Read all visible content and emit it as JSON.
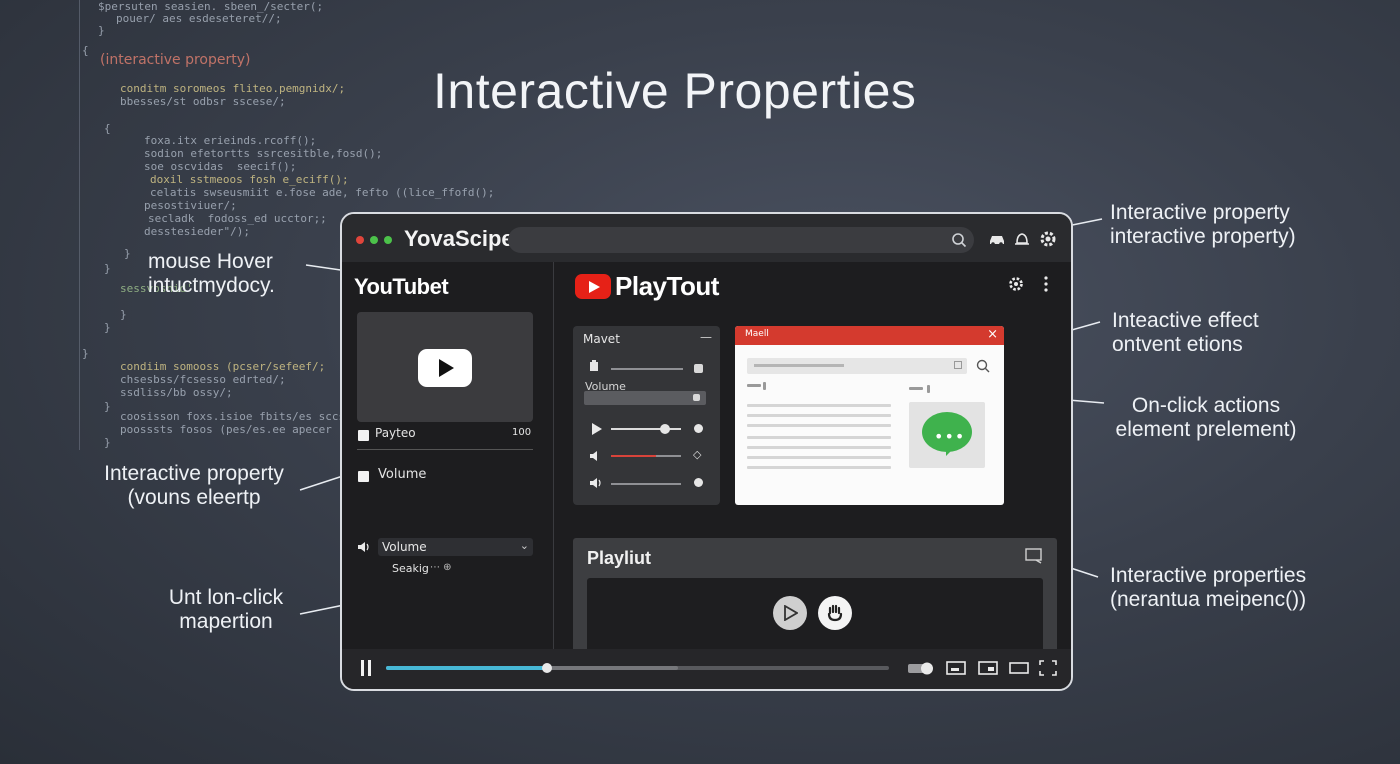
{
  "page_title": "Interactive Properties",
  "code_background": {
    "highlight_text": "(interactive property)"
  },
  "annotations": {
    "top_right": [
      "Interactive property",
      "interactive property)"
    ],
    "mouse_hover": [
      "mouse Hover",
      "intuctmydocy."
    ],
    "effect": [
      "Inteactive effect",
      "ontvent etions"
    ],
    "onclick_actions": [
      "On-click actions",
      "element prelement)"
    ],
    "left_property": [
      "Interactive property",
      "(vouns eleertp"
    ],
    "unt_onclick": [
      "Unt lon-click",
      "mapertion"
    ],
    "bottom_right": [
      "Interactive properties",
      "(nerantua meipenc())"
    ]
  },
  "window": {
    "app_name": "YovaScipe",
    "sidebar": {
      "logo": "YouTubet",
      "row_playlist": "Payteo",
      "row_playlist_count": "100",
      "row_volume": "Volume",
      "select_value": "Volume",
      "seeking_label": "Seakig"
    },
    "main": {
      "title": "PlayTout",
      "mixer_title": "Mavet",
      "mixer_volume_label": "Volume",
      "dialog_title": "Maell",
      "playlist_title": "Playliut"
    },
    "progress": {
      "played": 0.32,
      "buffered": 0.58
    }
  },
  "colors": {
    "accent_blue": "#47b8d6",
    "youtube_red": "#e62117",
    "dialog_red": "#d43a2e",
    "chat_green": "#3fb24d"
  }
}
